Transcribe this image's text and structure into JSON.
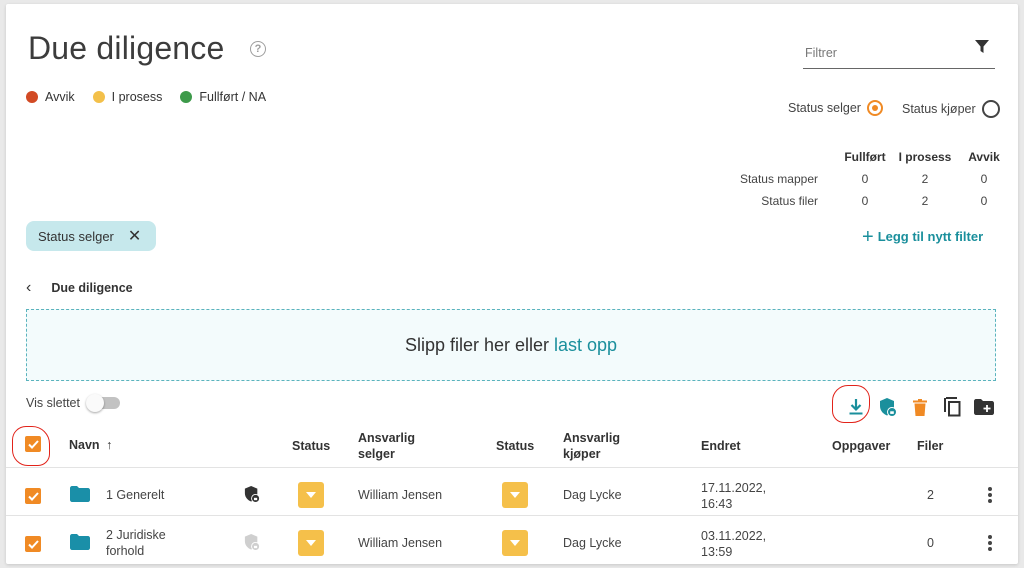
{
  "page": {
    "title": "Due diligence",
    "legend": [
      {
        "label": "Avvik",
        "color": "#d24a24"
      },
      {
        "label": "I prosess",
        "color": "#f3c04a"
      },
      {
        "label": "Fullført / NA",
        "color": "#3d9a4a"
      }
    ]
  },
  "filter": {
    "placeholder": "Filtrer"
  },
  "status_toggle": {
    "seller_label": "Status selger",
    "buyer_label": "Status kjøper",
    "selected": "Status selger"
  },
  "stats": {
    "headers": [
      "Fullført",
      "I prosess",
      "Avvik"
    ],
    "rows": [
      {
        "label": "Status mapper",
        "values": [
          "0",
          "2",
          "0"
        ]
      },
      {
        "label": "Status filer",
        "values": [
          "0",
          "2",
          "0"
        ]
      }
    ]
  },
  "active_filter_chip": {
    "label": "Status selger"
  },
  "add_filter": {
    "label": "Legg til nytt filter"
  },
  "breadcrumb": {
    "label": "Due diligence"
  },
  "dropzone": {
    "text": "Slipp filer her eller",
    "link": "last opp"
  },
  "show_deleted": {
    "label": "Vis slettet",
    "on": false
  },
  "toolbar": {
    "icons": [
      "download-icon",
      "shield-lock-icon",
      "trash-icon",
      "copy-icon",
      "folder-plus-icon"
    ]
  },
  "table": {
    "headers": {
      "name": "Navn",
      "status_seller": "Status",
      "responsible_seller_1": "Ansvarlig",
      "responsible_seller_2": "selger",
      "status_buyer": "Status",
      "responsible_buyer_1": "Ansvarlig",
      "responsible_buyer_2": "kjøper",
      "changed": "Endret",
      "tasks": "Oppgaver",
      "files": "Filer"
    },
    "rows": [
      {
        "name_1": "1 Generelt",
        "name_2": "",
        "seller": "William Jensen",
        "buyer": "Dag Lycke",
        "changed_date": "17.11.2022,",
        "changed_time": "16:43",
        "tasks": "",
        "files": "2",
        "checked": true,
        "locked": true
      },
      {
        "name_1": "2 Juridiske",
        "name_2": "forhold",
        "seller": "William Jensen",
        "buyer": "Dag Lycke",
        "changed_date": "03.11.2022,",
        "changed_time": "13:59",
        "tasks": "",
        "files": "0",
        "checked": true,
        "locked": false
      }
    ]
  },
  "colors": {
    "accent_orange": "#f08a24",
    "teal": "#1a8f9c",
    "status_yellow": "#f5c04a"
  }
}
